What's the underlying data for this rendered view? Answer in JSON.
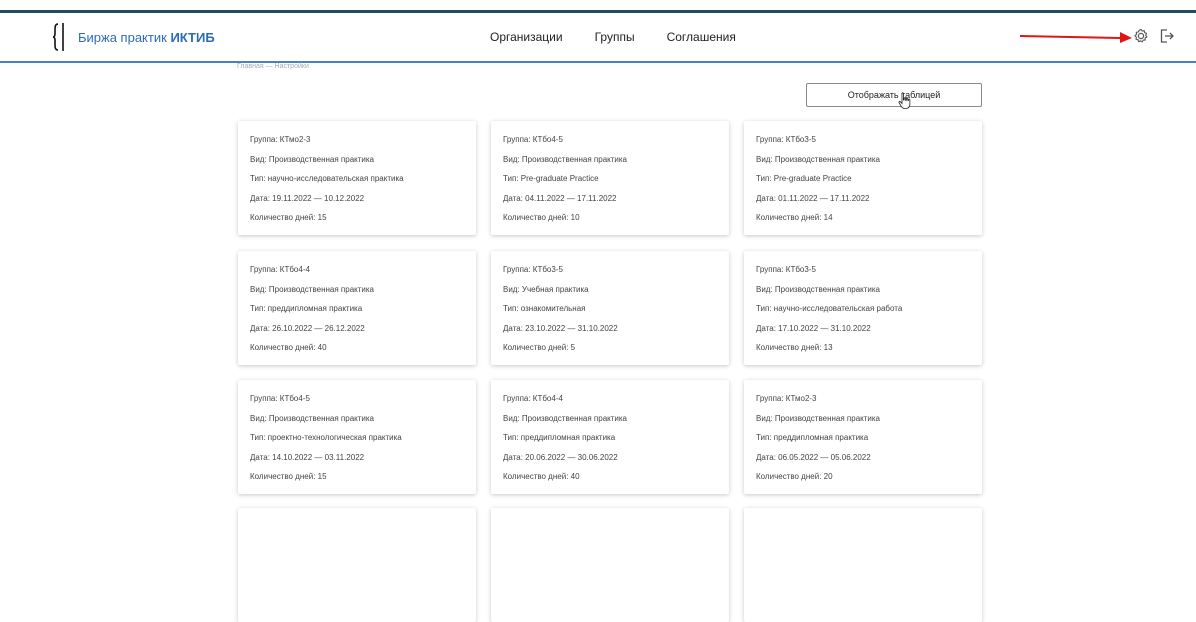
{
  "header": {
    "logo_text": "Биржа практик",
    "logo_bold": "ИКТИБ",
    "nav": [
      "Организации",
      "Группы",
      "Соглашения"
    ],
    "settings_icon": "gear-icon",
    "logout_icon": "logout-icon",
    "accent_color": "#2c6cb5"
  },
  "breadcrumb": "Главная — Настройки",
  "toggle_button": "Отображать таблицей",
  "cards": [
    {
      "group": "Группа: КТмо2-3",
      "kind": "Вид: Производственная практика",
      "type": "Тип: научно-исследовательская практика",
      "date": "Дата: 19.11.2022 — 10.12.2022",
      "days": "Количество дней: 15"
    },
    {
      "group": "Группа: КТбо4-5",
      "kind": "Вид: Производственная практика",
      "type": "Тип: Pre-graduate Practice",
      "date": "Дата: 04.11.2022 — 17.11.2022",
      "days": "Количество дней: 10"
    },
    {
      "group": "Группа: КТбо3-5",
      "kind": "Вид: Производственная практика",
      "type": "Тип: Pre-graduate Practice",
      "date": "Дата: 01.11.2022 — 17.11.2022",
      "days": "Количество дней: 14"
    },
    {
      "group": "Группа: КТбо4-4",
      "kind": "Вид: Производственная практика",
      "type": "Тип: преддипломная практика",
      "date": "Дата: 26.10.2022 — 26.12.2022",
      "days": "Количество дней: 40"
    },
    {
      "group": "Группа: КТбо3-5",
      "kind": "Вид: Учебная практика",
      "type": "Тип: ознакомительная",
      "date": "Дата: 23.10.2022 — 31.10.2022",
      "days": "Количество дней: 5"
    },
    {
      "group": "Группа: КТбо3-5",
      "kind": "Вид: Производственная практика",
      "type": "Тип: научно-исследовательская работа",
      "date": "Дата: 17.10.2022 — 31.10.2022",
      "days": "Количество дней: 13"
    },
    {
      "group": "Группа: КТбо4-5",
      "kind": "Вид: Производственная практика",
      "type": "Тип: проектно-технологическая практика",
      "date": "Дата: 14.10.2022 — 03.11.2022",
      "days": "Количество дней: 15"
    },
    {
      "group": "Группа: КТбо4-4",
      "kind": "Вид: Производственная практика",
      "type": "Тип: преддипломная практика",
      "date": "Дата: 20.06.2022 — 30.06.2022",
      "days": "Количество дней: 40"
    },
    {
      "group": "Группа: КТмо2-3",
      "kind": "Вид: Производственная практика",
      "type": "Тип: преддипломная практика",
      "date": "Дата: 06.05.2022 — 05.06.2022",
      "days": "Количество дней: 20"
    }
  ]
}
